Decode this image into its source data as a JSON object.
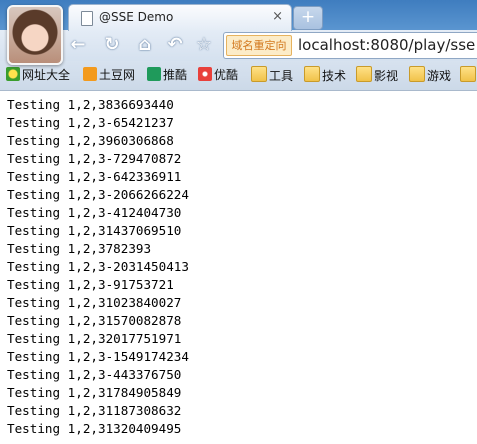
{
  "tab": {
    "title": "@SSE Demo",
    "close": "×"
  },
  "new_tab": "+",
  "nav": {
    "back": "←",
    "reload": "↻",
    "home": "⌂",
    "undo": "↶",
    "star": "☆"
  },
  "urlbar": {
    "badge": "域名重定向",
    "url": "localhost:8080/play/sse"
  },
  "bookmarks": [
    {
      "label": "网址大全",
      "icon": "hao123-icon"
    },
    {
      "label": "土豆网",
      "icon": "tudou-icon"
    },
    {
      "label": "推酷",
      "icon": "tuicool-icon"
    },
    {
      "label": "优酷",
      "icon": "youku-icon"
    },
    {
      "label": "工具",
      "icon": "folder-icon"
    },
    {
      "label": "技术",
      "icon": "folder-icon"
    },
    {
      "label": "影视",
      "icon": "folder-icon"
    },
    {
      "label": "游戏",
      "icon": "folder-icon"
    }
  ],
  "lines": [
    "Testing 1,2,3836693440",
    "Testing 1,2,3-65421237",
    "Testing 1,2,3960306868",
    "Testing 1,2,3-729470872",
    "Testing 1,2,3-642336911",
    "Testing 1,2,3-2066266224",
    "Testing 1,2,3-412404730",
    "Testing 1,2,31437069510",
    "Testing 1,2,3782393",
    "Testing 1,2,3-2031450413",
    "Testing 1,2,3-91753721",
    "Testing 1,2,31023840027",
    "Testing 1,2,31570082878",
    "Testing 1,2,32017751971",
    "Testing 1,2,3-1549174234",
    "Testing 1,2,3-443376750",
    "Testing 1,2,31784905849",
    "Testing 1,2,31187308632",
    "Testing 1,2,31320409495"
  ]
}
